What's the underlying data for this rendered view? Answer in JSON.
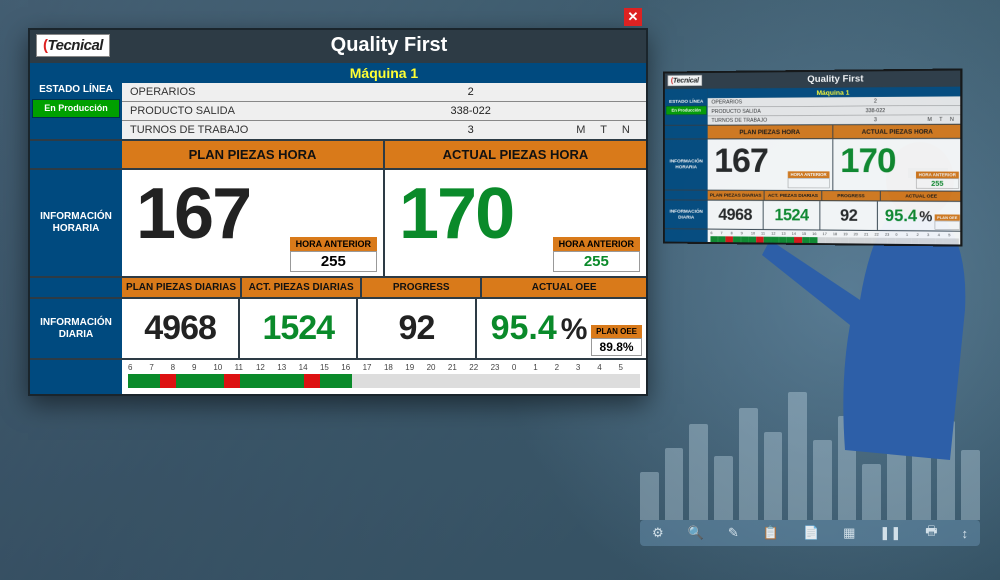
{
  "brand": "Tecnical",
  "title": "Quality First",
  "machine": "Máquina 1",
  "line_state": {
    "label": "ESTADO LÍNEA",
    "status": "En Producción"
  },
  "info_rows": {
    "operarios": {
      "label": "OPERARIOS",
      "value": "2"
    },
    "producto": {
      "label": "PRODUCTO SALIDA",
      "value": "338-022"
    },
    "turnos": {
      "label": "TURNOS DE TRABAJO",
      "value": "3",
      "shifts": "M T N"
    }
  },
  "hourly": {
    "section_label": "INFORMACIÓN HORARIA",
    "plan": {
      "header": "PLAN PIEZAS HORA",
      "value": "167",
      "prev_label": "HORA ANTERIOR",
      "prev_value": "255"
    },
    "actual": {
      "header": "ACTUAL PIEZAS HORA",
      "value": "170",
      "prev_label": "HORA ANTERIOR",
      "prev_value": "255"
    }
  },
  "daily": {
    "section_label": "INFORMACIÓN DIARIA",
    "headers": {
      "plan": "PLAN PIEZAS DIARIAS",
      "actual": "ACT. PIEZAS DIARIAS",
      "progress": "PROGRESS",
      "oee": "ACTUAL OEE"
    },
    "plan": "4968",
    "actual": "1524",
    "progress": "92",
    "oee": "95.4",
    "oee_unit": "%",
    "plan_oee_label": "PLAN OEE",
    "plan_oee": "89.8%"
  },
  "timeline_hours": [
    "6",
    "7",
    "8",
    "9",
    "10",
    "11",
    "12",
    "13",
    "14",
    "15",
    "16",
    "17",
    "18",
    "19",
    "20",
    "21",
    "22",
    "23",
    "0",
    "1",
    "2",
    "3",
    "4",
    "5"
  ],
  "timeline_status": [
    "g",
    "g",
    "r",
    "g",
    "g",
    "g",
    "r",
    "g",
    "g",
    "g",
    "g",
    "r",
    "g",
    "g",
    "w",
    "w",
    "w",
    "w",
    "w",
    "w",
    "w",
    "w",
    "w",
    "w",
    "w",
    "w",
    "w",
    "w",
    "w",
    "w",
    "w",
    "w"
  ]
}
